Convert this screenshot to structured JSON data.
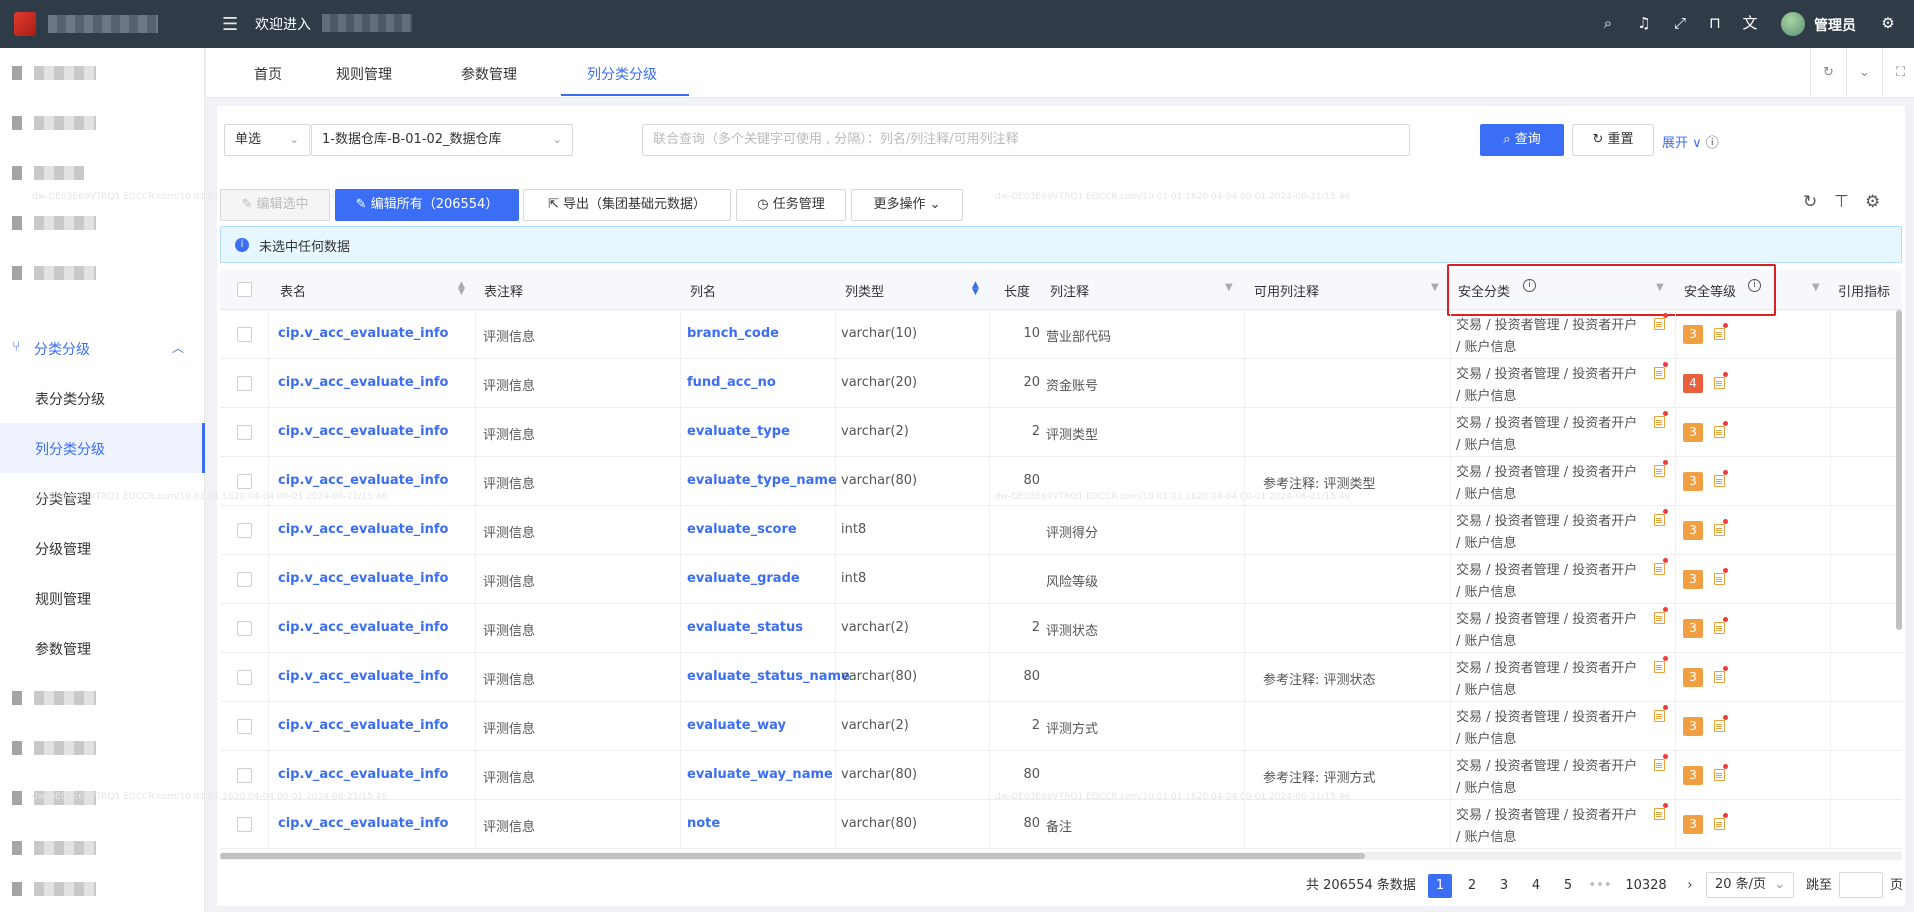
{
  "header": {
    "welcome": "欢迎进入",
    "username": "管理员",
    "icons": [
      "menu-fold-icon",
      "search-icon",
      "bell-icon",
      "fullscreen-icon",
      "lock-icon",
      "translate-icon",
      "avatar",
      "settings-icon"
    ]
  },
  "sidebar": {
    "group_label": "分类分级",
    "sub_items": [
      "表分类分级",
      "列分类分级",
      "分类管理",
      "分级管理",
      "规则管理",
      "参数管理"
    ],
    "active_sub": "列分类分级"
  },
  "tabs": {
    "items": [
      "首页",
      "规则管理",
      "参数管理",
      "列分类分级"
    ],
    "active": "列分类分级"
  },
  "filters": {
    "mode": "单选",
    "datasource": "1-数据仓库-B-01-02_数据仓库",
    "search_placeholder": "联合查询（多个关键字可使用 , 分隔）：列名/列注释/可用列注释",
    "query_label": "查询",
    "reset_label": "重置",
    "expand_label": "展开"
  },
  "toolbar": {
    "edit_selected": "编辑选中",
    "edit_all": "编辑所有（206554）",
    "export": "导出（集团基础元数据）",
    "task_manage": "任务管理",
    "more_actions": "更多操作"
  },
  "alert": {
    "text": "未选中任何数据"
  },
  "table": {
    "columns": [
      "表名",
      "表注释",
      "列名",
      "列类型",
      "长度",
      "列注释",
      "可用列注释",
      "安全分类",
      "安全等级",
      "引用指标"
    ],
    "rows": [
      {
        "table": "cip.v_acc_evaluate_info",
        "table_comment": "评测信息",
        "column": "branch_code",
        "type": "varchar(10)",
        "length": "10",
        "comment": "营业部代码",
        "usable_comment": "",
        "cat1": "交易 / 投资者管理 / 投资者开户",
        "cat2": "/ 账户信息",
        "level": "3"
      },
      {
        "table": "cip.v_acc_evaluate_info",
        "table_comment": "评测信息",
        "column": "fund_acc_no",
        "type": "varchar(20)",
        "length": "20",
        "comment": "资金账号",
        "usable_comment": "",
        "cat1": "交易 / 投资者管理 / 投资者开户",
        "cat2": "/ 账户信息",
        "level": "4"
      },
      {
        "table": "cip.v_acc_evaluate_info",
        "table_comment": "评测信息",
        "column": "evaluate_type",
        "type": "varchar(2)",
        "length": "2",
        "comment": "评测类型",
        "usable_comment": "",
        "cat1": "交易 / 投资者管理 / 投资者开户",
        "cat2": "/ 账户信息",
        "level": "3"
      },
      {
        "table": "cip.v_acc_evaluate_info",
        "table_comment": "评测信息",
        "column": "evaluate_type_name",
        "type": "varchar(80)",
        "length": "80",
        "comment": "",
        "usable_comment": "参考注释: 评测类型",
        "cat1": "交易 / 投资者管理 / 投资者开户",
        "cat2": "/ 账户信息",
        "level": "3"
      },
      {
        "table": "cip.v_acc_evaluate_info",
        "table_comment": "评测信息",
        "column": "evaluate_score",
        "type": "int8",
        "length": "",
        "comment": "评测得分",
        "usable_comment": "",
        "cat1": "交易 / 投资者管理 / 投资者开户",
        "cat2": "/ 账户信息",
        "level": "3"
      },
      {
        "table": "cip.v_acc_evaluate_info",
        "table_comment": "评测信息",
        "column": "evaluate_grade",
        "type": "int8",
        "length": "",
        "comment": "风险等级",
        "usable_comment": "",
        "cat1": "交易 / 投资者管理 / 投资者开户",
        "cat2": "/ 账户信息",
        "level": "3"
      },
      {
        "table": "cip.v_acc_evaluate_info",
        "table_comment": "评测信息",
        "column": "evaluate_status",
        "type": "varchar(2)",
        "length": "2",
        "comment": "评测状态",
        "usable_comment": "",
        "cat1": "交易 / 投资者管理 / 投资者开户",
        "cat2": "/ 账户信息",
        "level": "3"
      },
      {
        "table": "cip.v_acc_evaluate_info",
        "table_comment": "评测信息",
        "column": "evaluate_status_name",
        "type": "varchar(80)",
        "length": "80",
        "comment": "",
        "usable_comment": "参考注释: 评测状态",
        "cat1": "交易 / 投资者管理 / 投资者开户",
        "cat2": "/ 账户信息",
        "level": "3"
      },
      {
        "table": "cip.v_acc_evaluate_info",
        "table_comment": "评测信息",
        "column": "evaluate_way",
        "type": "varchar(2)",
        "length": "2",
        "comment": "评测方式",
        "usable_comment": "",
        "cat1": "交易 / 投资者管理 / 投资者开户",
        "cat2": "/ 账户信息",
        "level": "3"
      },
      {
        "table": "cip.v_acc_evaluate_info",
        "table_comment": "评测信息",
        "column": "evaluate_way_name",
        "type": "varchar(80)",
        "length": "80",
        "comment": "",
        "usable_comment": "参考注释: 评测方式",
        "cat1": "交易 / 投资者管理 / 投资者开户",
        "cat2": "/ 账户信息",
        "level": "3"
      },
      {
        "table": "cip.v_acc_evaluate_info",
        "table_comment": "评测信息",
        "column": "note",
        "type": "varchar(80)",
        "length": "80",
        "comment": "备注",
        "usable_comment": "",
        "cat1": "交易 / 投资者管理 / 投资者开户",
        "cat2": "/ 账户信息",
        "level": "3"
      }
    ]
  },
  "pagination": {
    "total": "共 206554 条数据",
    "pages": [
      "1",
      "2",
      "3",
      "4",
      "5"
    ],
    "ellipsis": "•••",
    "last_page": "10328",
    "page_size": "20 条/页",
    "jump_label": "跳至",
    "page_unit": "页"
  },
  "colors": {
    "primary": "#3b6ef5",
    "topbar": "#2f3b47",
    "level_mid": "#f0a043",
    "level_high": "#e8603c",
    "highlight": "#e02020"
  }
}
